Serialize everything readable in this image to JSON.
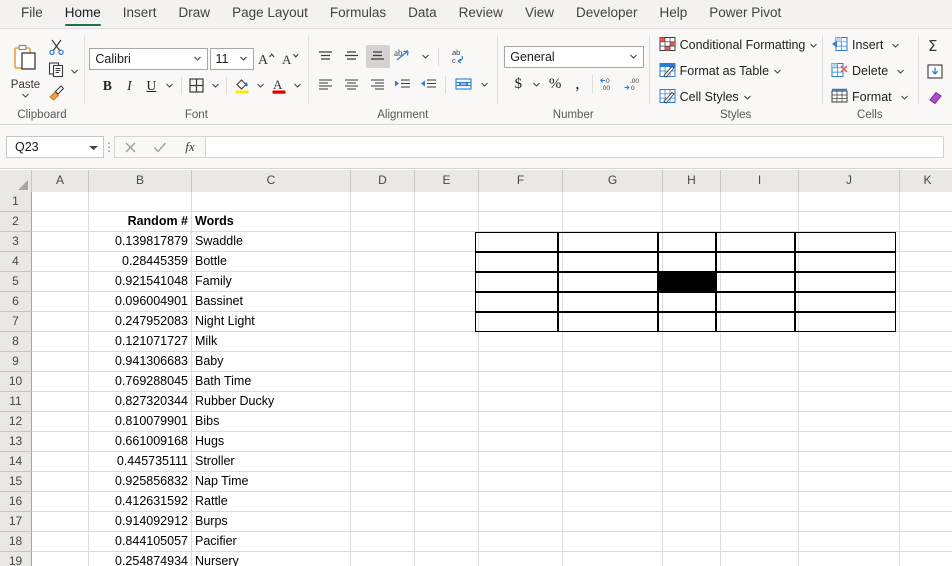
{
  "ribbon": {
    "tabs": [
      {
        "label": "File",
        "active": false
      },
      {
        "label": "Home",
        "active": true
      },
      {
        "label": "Insert",
        "active": false
      },
      {
        "label": "Draw",
        "active": false
      },
      {
        "label": "Page Layout",
        "active": false
      },
      {
        "label": "Formulas",
        "active": false
      },
      {
        "label": "Data",
        "active": false
      },
      {
        "label": "Review",
        "active": false
      },
      {
        "label": "View",
        "active": false
      },
      {
        "label": "Developer",
        "active": false
      },
      {
        "label": "Help",
        "active": false
      },
      {
        "label": "Power Pivot",
        "active": false
      }
    ],
    "groups": {
      "clipboard": {
        "label": "Clipboard",
        "paste_label": "Paste",
        "cut_name": "cut-icon",
        "copy_name": "copy-icon",
        "format_painter_name": "format-painter-icon"
      },
      "font": {
        "label": "Font",
        "font_name": "Calibri",
        "font_size": "11",
        "bold_label": "B",
        "italic_label": "I",
        "underline_label": "U"
      },
      "alignment": {
        "label": "Alignment"
      },
      "number": {
        "label": "Number",
        "format": "General",
        "currency_label": "$",
        "percent_label": "%",
        "comma_label": ","
      },
      "styles": {
        "label": "Styles",
        "conditional_formatting": "Conditional Formatting",
        "format_as_table": "Format as Table",
        "cell_styles": "Cell Styles"
      },
      "cells": {
        "label": "Cells",
        "insert": "Insert",
        "delete": "Delete",
        "format": "Format"
      },
      "editing": {
        "label": ""
      }
    }
  },
  "formula_bar": {
    "name_box": "Q23",
    "formula": "",
    "cancel_name": "cancel-icon",
    "enter_name": "enter-icon",
    "fx_label": "fx"
  },
  "grid": {
    "columns": [
      {
        "label": "A",
        "width": 57
      },
      {
        "label": "B",
        "width": 103
      },
      {
        "label": "C",
        "width": 159
      },
      {
        "label": "D",
        "width": 64
      },
      {
        "label": "E",
        "width": 64
      },
      {
        "label": "F",
        "width": 84
      },
      {
        "label": "G",
        "width": 100
      },
      {
        "label": "H",
        "width": 58
      },
      {
        "label": "I",
        "width": 78
      },
      {
        "label": "J",
        "width": 101
      },
      {
        "label": "K",
        "width": 56
      }
    ],
    "rows": [
      {
        "num": "1",
        "B": "",
        "C": ""
      },
      {
        "num": "2",
        "B": "Random #",
        "C": "Words",
        "bold": true
      },
      {
        "num": "3",
        "B": "0.139817879",
        "C": "Swaddle"
      },
      {
        "num": "4",
        "B": "0.28445359",
        "C": "Bottle"
      },
      {
        "num": "5",
        "B": "0.921541048",
        "C": "Family"
      },
      {
        "num": "6",
        "B": "0.096004901",
        "C": "Bassinet"
      },
      {
        "num": "7",
        "B": "0.247952083",
        "C": "Night Light"
      },
      {
        "num": "8",
        "B": "0.121071727",
        "C": "Milk"
      },
      {
        "num": "9",
        "B": "0.941306683",
        "C": "Baby"
      },
      {
        "num": "10",
        "B": "0.769288045",
        "C": "Bath Time"
      },
      {
        "num": "11",
        "B": "0.827320344",
        "C": "Rubber Ducky"
      },
      {
        "num": "12",
        "B": "0.810079901",
        "C": "Bibs"
      },
      {
        "num": "13",
        "B": "0.661009168",
        "C": "Hugs"
      },
      {
        "num": "14",
        "B": "0.445735111",
        "C": "Stroller"
      },
      {
        "num": "15",
        "B": "0.925856832",
        "C": "Nap Time"
      },
      {
        "num": "16",
        "B": "0.412631592",
        "C": "Rattle"
      },
      {
        "num": "17",
        "B": "0.914092912",
        "C": "Burps"
      },
      {
        "num": "18",
        "B": "0.844105057",
        "C": "Pacifier"
      },
      {
        "num": "19",
        "B": "0.254874934",
        "C": "Nursery"
      }
    ],
    "bordered_range": "F3:J7",
    "filled_cell": "H5",
    "filled_cell_color": "#000000"
  }
}
